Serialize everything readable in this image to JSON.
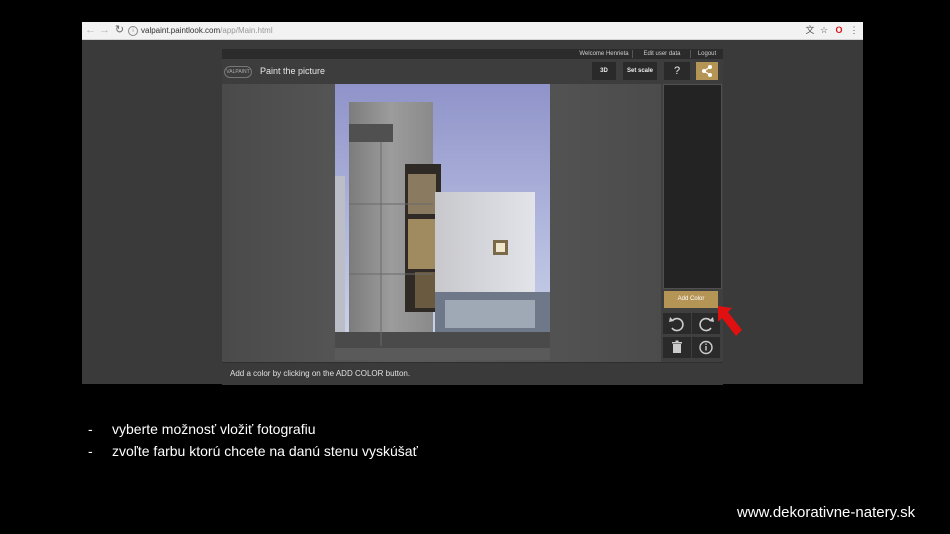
{
  "browser": {
    "url_host": "valpaint.paintlook.com",
    "url_path": "/app/Main.html",
    "icons": [
      "back-icon",
      "forward-icon",
      "reload-icon",
      "info-icon",
      "translate-icon",
      "star-icon",
      "opera-icon",
      "menu-icon"
    ]
  },
  "app": {
    "top_links": {
      "welcome": "Welcome Henrieta",
      "edit_user": "Edit user data",
      "logout": "Logout"
    },
    "logo_text": "VALPAINT",
    "title": "Paint the picture",
    "buttons": {
      "three_d": "3D",
      "set_scale": "Set scale",
      "help": "?"
    },
    "add_color": "Add Color",
    "status": "Add a color by clicking on the ADD COLOR button.",
    "accent_color": "#b59556"
  },
  "slide": {
    "bullets": [
      {
        "dash": "-",
        "text": "vyberte možnosť vložiť fotografiu"
      },
      {
        "dash": "-",
        "text": "zvoľte farbu ktorú chcete na danú stenu vyskúšať"
      }
    ],
    "website": "www.dekorativne-natery.sk",
    "arrow_color": "#e01010"
  }
}
